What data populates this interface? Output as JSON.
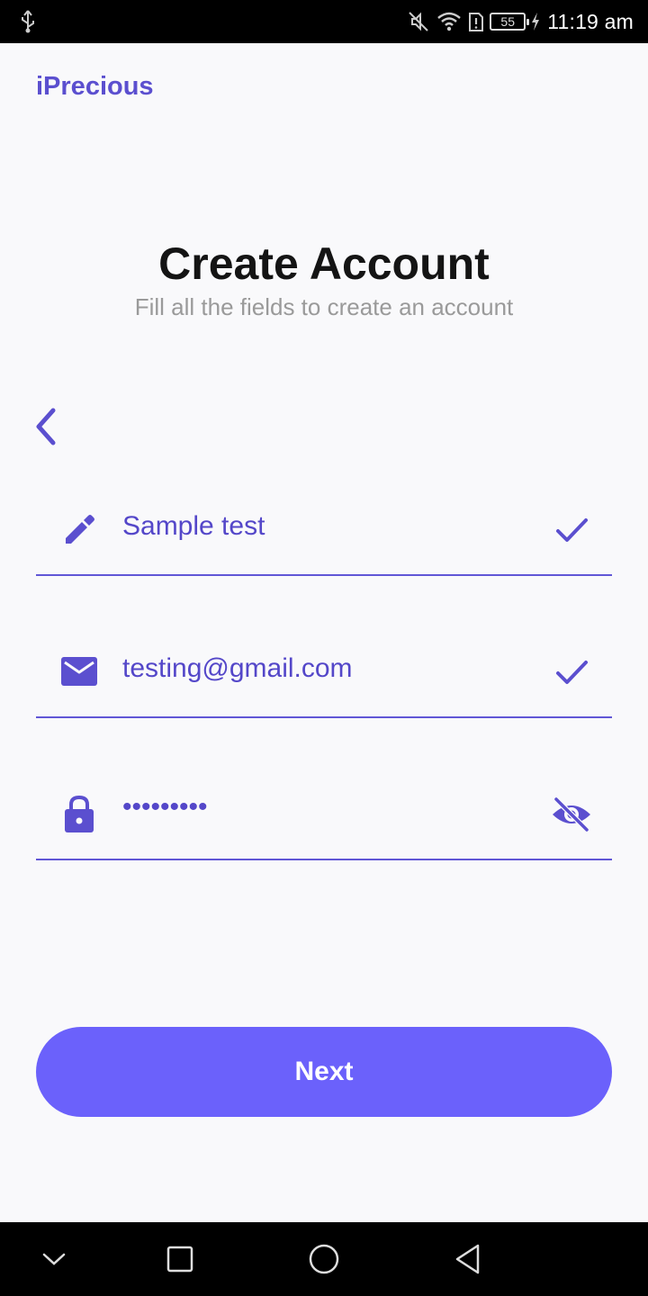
{
  "status_bar": {
    "battery_level": "55",
    "time": "11:19 am",
    "icons": [
      "usb-icon",
      "mute-icon",
      "wifi-icon",
      "alert-icon",
      "battery-icon",
      "charging-icon"
    ]
  },
  "app": {
    "brand": "iPrecious",
    "title": "Create Account",
    "subtitle": "Fill all the fields to create an account"
  },
  "form": {
    "name": {
      "value": "Sample test",
      "icon": "pencil-icon",
      "status_icon": "check-icon"
    },
    "email": {
      "value": "testing@gmail.com",
      "icon": "mail-icon",
      "status_icon": "check-icon"
    },
    "password": {
      "masked_value": "•••••••••",
      "icon": "lock-icon",
      "toggle_icon": "eye-off-icon"
    }
  },
  "actions": {
    "next_label": "Next"
  },
  "colors": {
    "accent": "#5b4fcf",
    "button": "#6b61fb",
    "background": "#f9f9fb",
    "title": "#141414",
    "subtitle": "#9a9a9a"
  },
  "nav_bar": {
    "icons": [
      "chevron-down-icon",
      "recents-icon",
      "home-icon",
      "back-icon"
    ]
  }
}
